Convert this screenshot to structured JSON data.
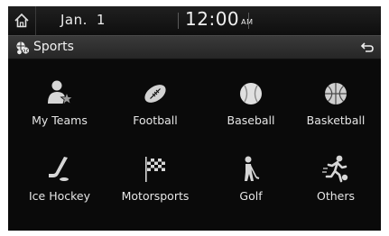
{
  "status_bar": {
    "month": "Jan.",
    "day": "1",
    "time": "12:00",
    "ampm": "AM"
  },
  "title_bar": {
    "title": "Sports",
    "title_icon": "sports-balls-icon",
    "back_icon": "back-arrow-icon"
  },
  "categories": [
    {
      "label": "My Teams",
      "icon": "my-teams-icon"
    },
    {
      "label": "Football",
      "icon": "football-icon"
    },
    {
      "label": "Baseball",
      "icon": "baseball-icon"
    },
    {
      "label": "Basketball",
      "icon": "basketball-icon"
    },
    {
      "label": "Ice Hockey",
      "icon": "ice-hockey-icon"
    },
    {
      "label": "Motorsports",
      "icon": "motorsports-flag-icon"
    },
    {
      "label": "Golf",
      "icon": "golf-icon"
    },
    {
      "label": "Others",
      "icon": "others-runner-icon"
    }
  ],
  "colors": {
    "background": "#0a0a0a",
    "icon": "#d8d8d8",
    "text": "#e6e6e6"
  }
}
